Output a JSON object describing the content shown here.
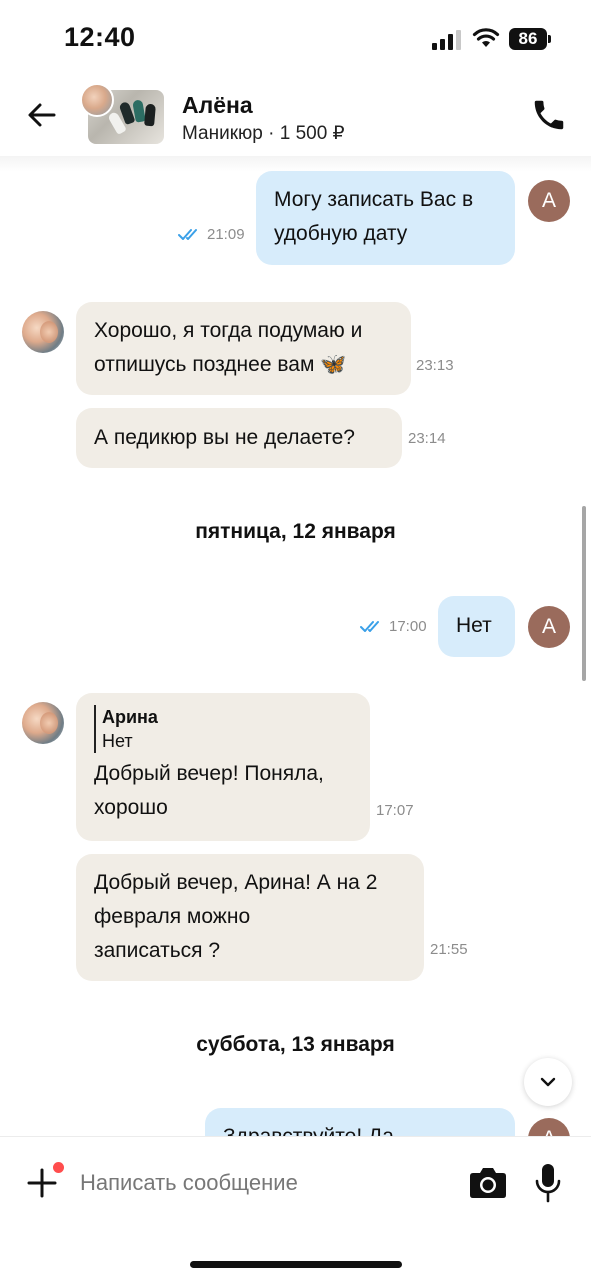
{
  "status_bar": {
    "time": "12:40",
    "battery": "86"
  },
  "header": {
    "name": "Алёна",
    "subtitle": "Маникюр · 1 500 ₽"
  },
  "messages": [
    {
      "direction": "out",
      "text_lines": [
        "Могу записать Вас в",
        "удобную дату"
      ],
      "time": "21:09",
      "avatar_letter": "А"
    },
    {
      "direction": "in",
      "text_lines": [
        "Хорошо, я тогда подумаю и",
        "отпишусь позднее вам 🦋"
      ],
      "time": "23:13"
    },
    {
      "direction": "in",
      "text_lines": [
        "А педикюр вы не делаете?"
      ],
      "time": "23:14"
    },
    {
      "direction": "out",
      "text_lines": [
        "Нет"
      ],
      "time": "17:00",
      "avatar_letter": "А"
    },
    {
      "direction": "in",
      "quote": {
        "author": "Арина",
        "text": "Нет"
      },
      "text_lines": [
        "Добрый вечер! Поняла,",
        "хорошо"
      ],
      "time": "17:07"
    },
    {
      "direction": "in",
      "text_lines": [
        "Добрый вечер, Арина! А на 2",
        "февраля можно",
        "записаться ?"
      ],
      "time": "21:55"
    },
    {
      "direction": "out",
      "text_lines": [
        "Здравствуйте! Да"
      ],
      "avatar_letter": "А"
    }
  ],
  "date_separators": [
    "пятница, 12 января",
    "суббота, 13 января"
  ],
  "input": {
    "placeholder": "Написать сообщение"
  },
  "icons": [
    "back-arrow-icon",
    "phone-icon",
    "double-check-icon",
    "chevron-down-icon",
    "plus-icon",
    "camera-icon",
    "microphone-icon"
  ],
  "colors": {
    "outgoing_bubble": "#d7ecfb",
    "incoming_bubble": "#f1ede6",
    "read_ticks": "#3aa0e8",
    "avatar_bg": "#9a6b5c",
    "notification_dot": "#ff4d4d"
  }
}
